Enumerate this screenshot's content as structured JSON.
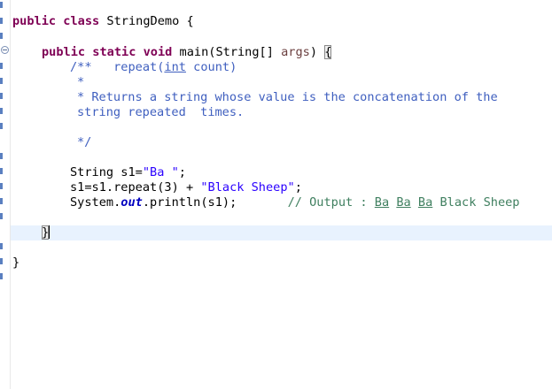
{
  "editor": {
    "lines": {
      "class_decl": {
        "kw": "public class",
        "name": "StringDemo",
        "brace": "{"
      },
      "main_decl": {
        "kw": "public static void",
        "name": "main",
        "params_open": "(String[] ",
        "param": "args",
        "params_close": ") ",
        "brace": "{"
      },
      "doc_open": {
        "marker": "/**",
        "text_before": "   repeat(",
        "u_word": "int",
        "text_after": " count)"
      },
      "doc_star": "*",
      "doc_line1": "* Returns a string whose value is the concatenation of the",
      "doc_line2": "string repeated  times.",
      "doc_close": "*/",
      "stmt1": {
        "type": "String s1=",
        "str": "\"Ba \"",
        "end": ";"
      },
      "stmt2": {
        "code": "s1=s1.repeat(3) + ",
        "str": "\"Black Sheep\"",
        "end": ";"
      },
      "stmt3": {
        "pre": "System.",
        "field": "out",
        "post": ".println(s1);",
        "gap": "       ",
        "comment_pre": "// Output : ",
        "cw1": "Ba",
        "cw2": "Ba",
        "cw3": "Ba",
        "comment_post": " Black Sheep"
      },
      "method_close": "}",
      "class_close": "}"
    }
  }
}
